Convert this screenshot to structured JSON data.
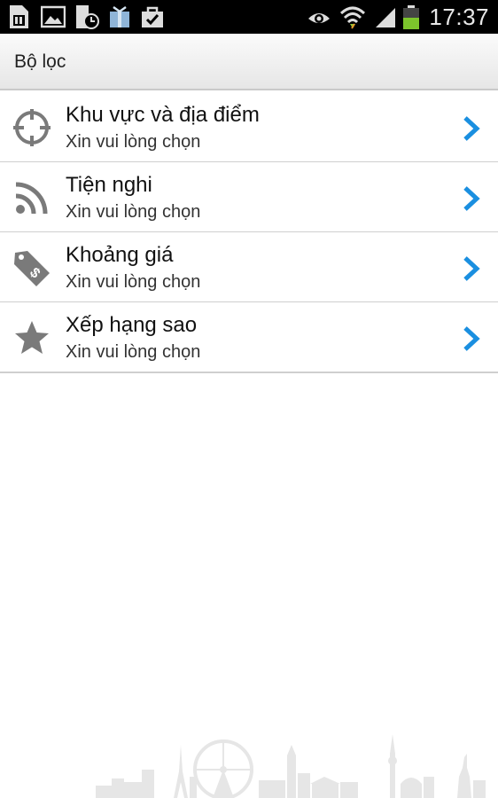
{
  "status_bar": {
    "time": "17:37",
    "icons": [
      "sim-card-icon",
      "image-icon",
      "sd-card-clock-icon",
      "gift-box-icon",
      "shopping-bag-check-icon",
      "eye-icon",
      "wifi-icon",
      "signal-icon",
      "battery-icon"
    ]
  },
  "header": {
    "title": "Bộ lọc"
  },
  "filters": [
    {
      "title": "Khu vực và địa điểm",
      "subtitle": "Xin vui lòng chọn",
      "icon": "crosshair-icon"
    },
    {
      "title": "Tiện nghi",
      "subtitle": "Xin vui lòng chọn",
      "icon": "wifi-rss-icon"
    },
    {
      "title": "Khoảng giá",
      "subtitle": "Xin vui lòng chọn",
      "icon": "price-tag-icon"
    },
    {
      "title": "Xếp hạng sao",
      "subtitle": "Xin vui lòng chọn",
      "icon": "star-icon"
    }
  ],
  "colors": {
    "chevron": "#1a8fe0",
    "icon_gray": "#7a7a7a",
    "skyline": "#e4e4e4"
  }
}
